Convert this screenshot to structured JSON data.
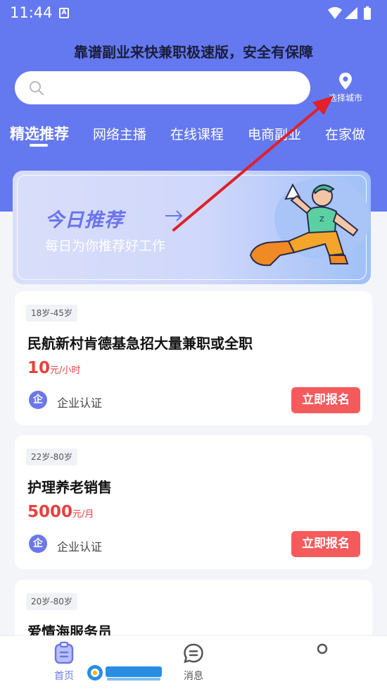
{
  "status_bar": {
    "time": "11:44",
    "notification_badge": "A"
  },
  "header": {
    "slogan": "靠谱副业来快兼职极速版，安全有保障",
    "search": {
      "placeholder": ""
    },
    "city": {
      "label": "选择城市",
      "icon": "location-pin-icon"
    }
  },
  "tabs": [
    {
      "label": "精选推荐",
      "active": true
    },
    {
      "label": "网络主播",
      "active": false
    },
    {
      "label": "在线课程",
      "active": false
    },
    {
      "label": "电商副业",
      "active": false
    },
    {
      "label": "在家做",
      "active": false
    }
  ],
  "banner": {
    "title": "今日推荐",
    "subtitle": "每日为你推荐好工作"
  },
  "jobs": [
    {
      "age": "18岁-45岁",
      "title": "民航新村肯德基急招大量兼职或全职",
      "salary_num": "10",
      "salary_unit": "元/小时",
      "cert_icon": "企",
      "cert_label": "企业认证",
      "apply": "立即报名"
    },
    {
      "age": "22岁-80岁",
      "title": "护理养老销售",
      "salary_num": "5000",
      "salary_unit": "元/月",
      "cert_icon": "企",
      "cert_label": "企业认证",
      "apply": "立即报名"
    },
    {
      "age": "20岁-80岁",
      "title": "爱情海服务员",
      "salary_num": "",
      "salary_unit": "",
      "cert_icon": "",
      "cert_label": "",
      "apply": ""
    }
  ],
  "tabbar": {
    "home": "首页",
    "messages": "消息",
    "me": ""
  },
  "colors": {
    "header_bg": "#6478f0",
    "accent": "#6c78ea",
    "apply_button": "#f55b5c",
    "salary": "#e8413f",
    "annotation_arrow": "#e0202a"
  }
}
